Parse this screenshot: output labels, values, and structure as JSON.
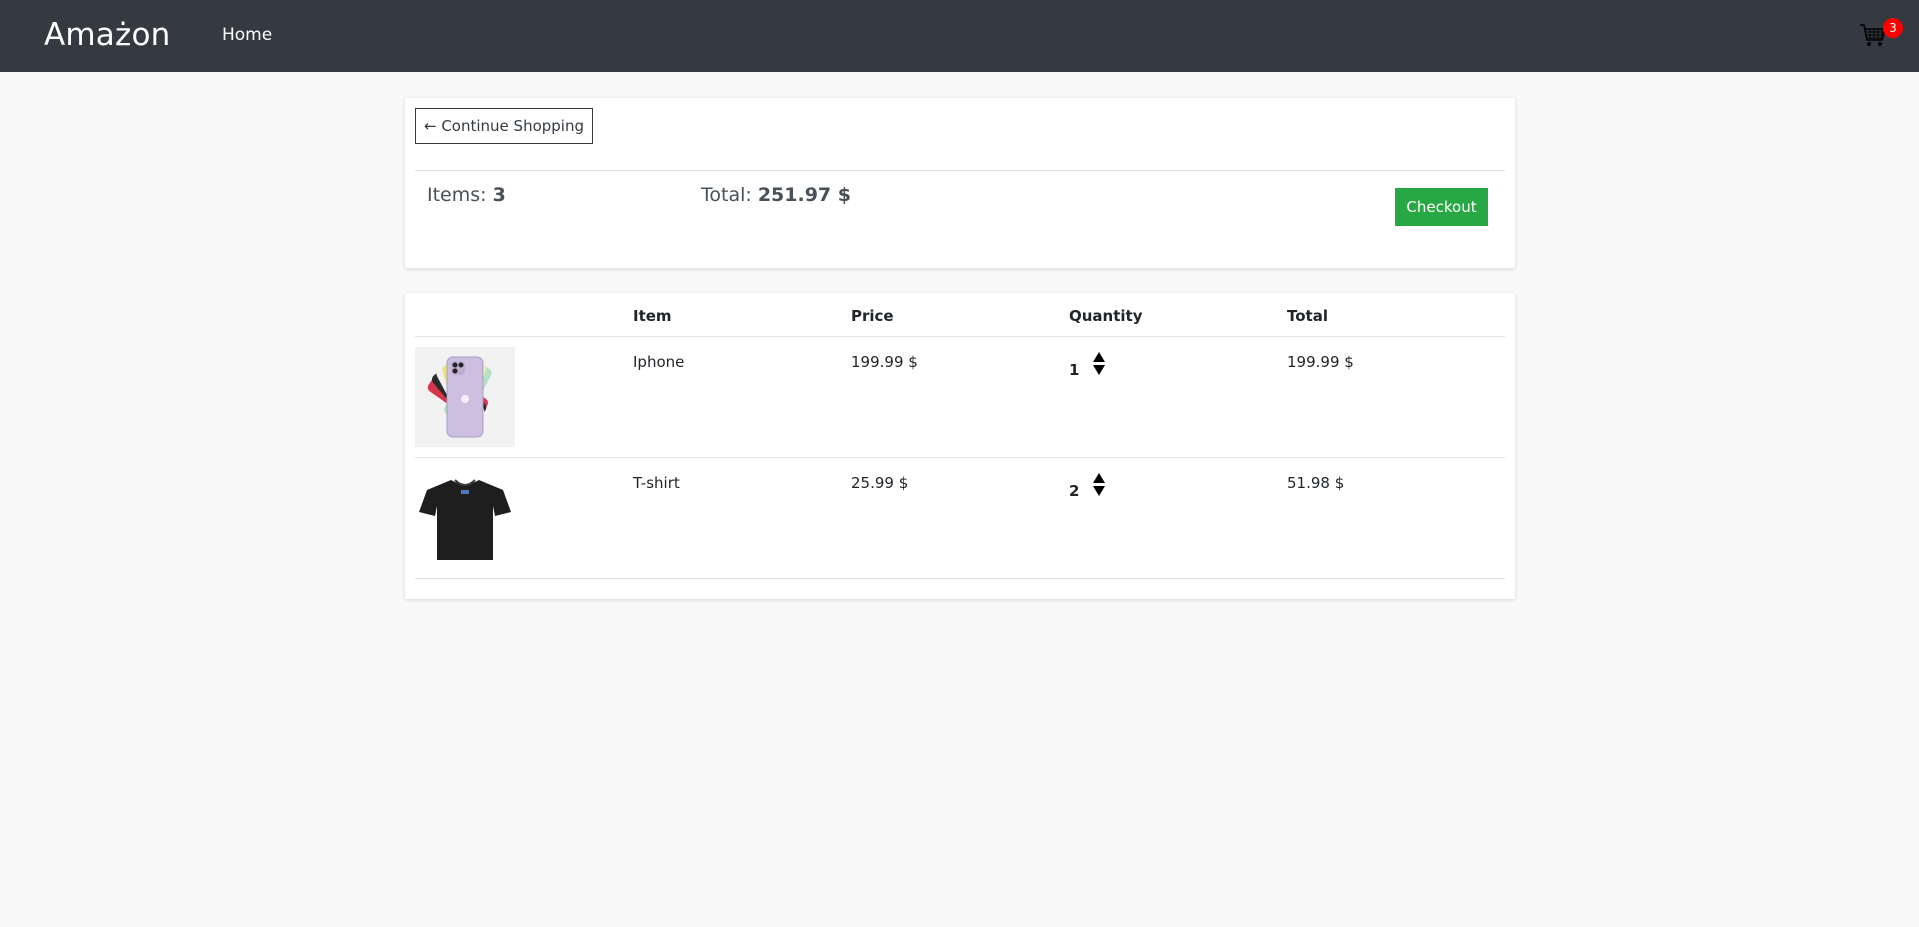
{
  "navbar": {
    "brand": "Amażon",
    "home_label": "Home",
    "cart_icon": "shopping-cart-icon",
    "cart_count": "3",
    "bg_color": "#343a40",
    "badge_color": "#ff0000"
  },
  "summary": {
    "continue_label": "← Continue Shopping",
    "items_label": "Items: ",
    "items_value": "3",
    "total_label": "Total: ",
    "total_value": "251.97 $",
    "checkout_label": "Checkout",
    "checkout_color": "#28a745"
  },
  "table": {
    "headers": [
      "Item",
      "Price",
      "Quantity",
      "Total"
    ],
    "rows": [
      {
        "image": "iphone-image",
        "item": "Iphone",
        "price": "199.99 $",
        "quantity": "1",
        "total": "199.99 $"
      },
      {
        "image": "tshirt-image",
        "item": "T-shirt",
        "price": "25.99 $",
        "quantity": "2",
        "total": "51.98 $"
      }
    ]
  }
}
